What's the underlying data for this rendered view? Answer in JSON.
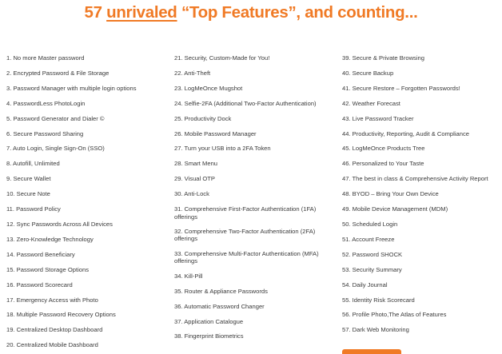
{
  "headline": {
    "prefix": "57 ",
    "emphasis": "unrivaled",
    "suffix": " “Top Features”, and counting..."
  },
  "colors": {
    "accent": "#f07a25",
    "text": "#3a3a3a",
    "background": "#ffffff"
  },
  "columns": [
    [
      "1. No more Master password",
      "2. Encrypted Password & File Storage",
      "3. Password Manager with multiple login options",
      "4. PasswordLess PhotoLogin",
      "5. Password Generator and Dialer ©",
      "6. Secure Password Sharing",
      "7. Auto Login, Single Sign-On (SSO)",
      "8. Autofill, Unlimited",
      "9. Secure Wallet",
      "10. Secure Note",
      "11. Password Policy",
      "12. Sync Passwords Across All Devices",
      "13. Zero-Knowledge Technology",
      "14. Password Beneficiary",
      "15. Password Storage Options",
      "16. Password Scorecard",
      "17. Emergency Access with Photo",
      "18. Multiple Password Recovery Options",
      "19. Centralized Desktop Dashboard",
      "20. Centralized Mobile Dashboard"
    ],
    [
      "21. Security, Custom-Made for You!",
      "22. Anti-Theft",
      "23. LogMeOnce Mugshot",
      "24. Selfie-2FA (Additional Two-Factor Authentication)",
      "25. Productivity Dock",
      "26. Mobile Password Manager",
      "27. Turn your USB into a 2FA Token",
      "28. Smart Menu",
      "29. Visual OTP",
      "30. Anti-Lock",
      "31. Comprehensive First-Factor Authentication (1FA) offerings",
      "32. Comprehensive Two-Factor Authentication (2FA) offerings",
      "33. Comprehensive Multi-Factor Authentication (MFA) offerings",
      "34. Kill-Pill",
      "35. Router & Appliance Passwords",
      "36. Automatic Password Changer",
      "37. Application Catalogue",
      "38. Fingerprint Biometrics"
    ],
    [
      "39. Secure & Private Browsing",
      "40. Secure Backup",
      "41. Secure Restore – Forgotten Passwords!",
      "42. Weather Forecast",
      "43. Live Password Tracker",
      "44. Productivity, Reporting, Audit & Compliance",
      "45. LogMeOnce Products Tree",
      "46. Personalized to Your Taste",
      "47. The best in class & Comprehensive Activity Report",
      "48. BYOD – Bring Your Own Device",
      "49. Mobile Device Management (MDM)",
      "50. Scheduled Login",
      "51. Account Freeze",
      "52. Password SHOCK",
      "53. Security Summary",
      "54. Daily Journal",
      "55. Identity Risk Scorecard",
      "56. Profile Photo,The Atlas of Features",
      "57. Dark Web Monitoring"
    ]
  ]
}
